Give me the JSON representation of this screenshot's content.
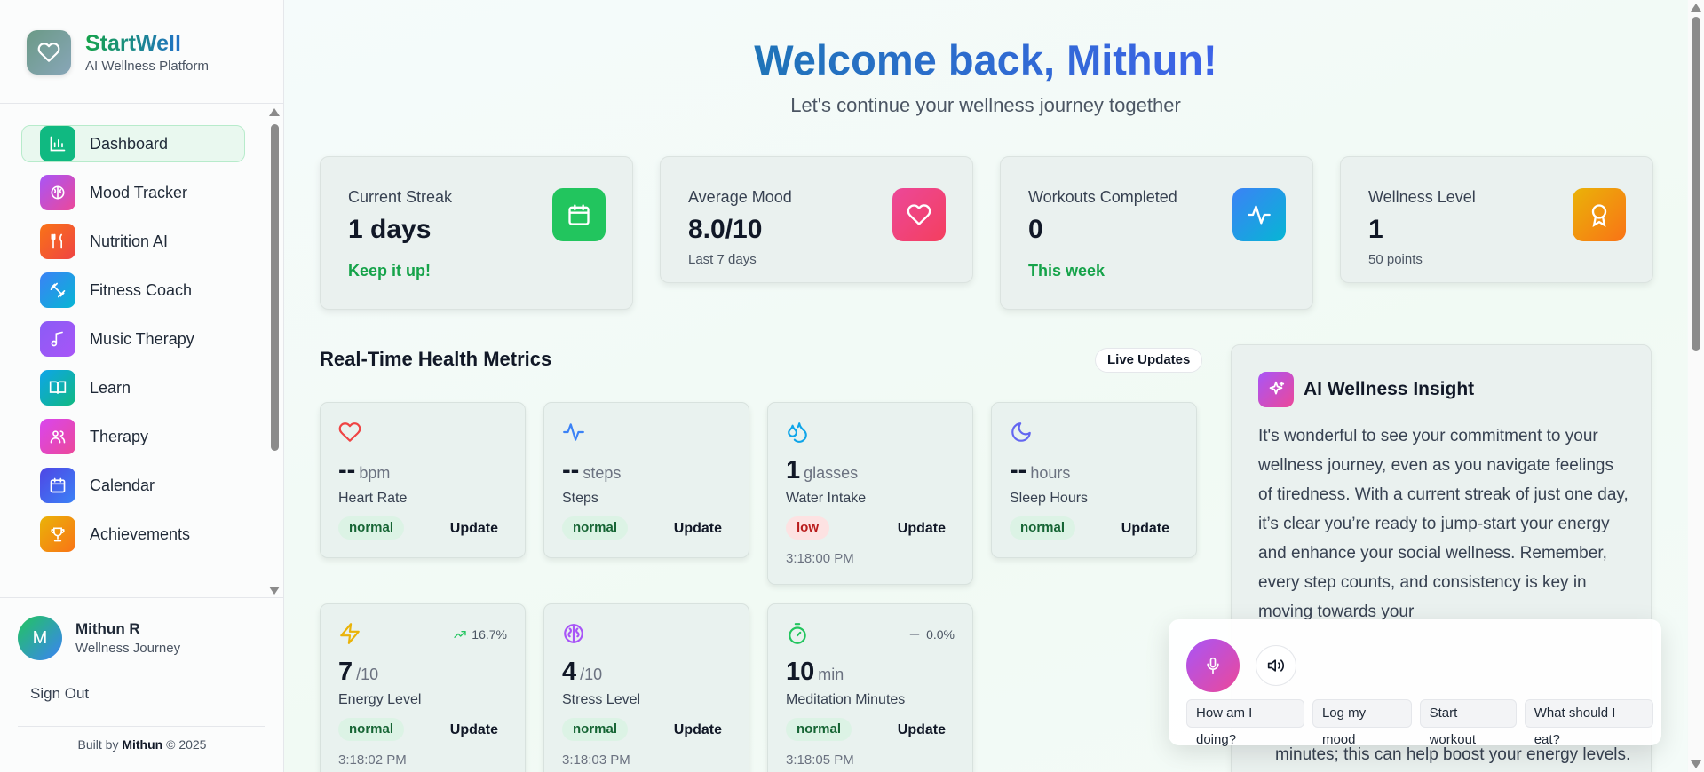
{
  "brand": {
    "name": "StartWell",
    "subtitle": "AI Wellness Platform"
  },
  "nav": {
    "items": [
      {
        "label": "Dashboard",
        "icon": "bar-chart-icon",
        "color": "#10b981",
        "active": true
      },
      {
        "label": "Mood Tracker",
        "icon": "brain-icon",
        "color": "#a855f7"
      },
      {
        "label": "Nutrition AI",
        "icon": "utensils-icon",
        "color": "#f97316"
      },
      {
        "label": "Fitness Coach",
        "icon": "dumbbell-icon",
        "color": "#3b82f6"
      },
      {
        "label": "Music Therapy",
        "icon": "music-icon",
        "color": "#8b5cf6"
      },
      {
        "label": "Learn",
        "icon": "book-icon",
        "color": "#0ea5e9"
      },
      {
        "label": "Therapy",
        "icon": "users-icon",
        "color": "#d946ef"
      },
      {
        "label": "Calendar",
        "icon": "calendar-icon",
        "color": "#4f46e5"
      },
      {
        "label": "Achievements",
        "icon": "trophy-icon",
        "color": "#f59e0b"
      }
    ]
  },
  "user": {
    "initial": "M",
    "name": "Mithun R",
    "subtitle": "Wellness Journey",
    "sign_out": "Sign Out"
  },
  "footer": {
    "prefix": "Built by",
    "author": "Mithun",
    "suffix": "© 2025"
  },
  "header": {
    "title": "Welcome back, Mithun!",
    "subtitle": "Let's continue your wellness journey together"
  },
  "stats": [
    {
      "label": "Current Streak",
      "value": "1 days",
      "note": "Keep it up!",
      "icon": "calendar-icon",
      "color": "#22c55e"
    },
    {
      "label": "Average Mood",
      "value": "8.0/10",
      "small": "Last 7 days",
      "icon": "heart-icon",
      "color": "#f43f5e"
    },
    {
      "label": "Workouts Completed",
      "value": "0",
      "note": "This week",
      "icon": "activity-icon",
      "color": "#3b82f6"
    },
    {
      "label": "Wellness Level",
      "value": "1",
      "small": "50 points",
      "icon": "award-icon",
      "color": "#f59e0b"
    }
  ],
  "metrics_section": {
    "title": "Real-Time Health Metrics",
    "badge": "Live Updates"
  },
  "metrics": [
    {
      "value": "--",
      "unit": "bpm",
      "label": "Heart Rate",
      "status": "normal",
      "update": "Update",
      "icon": "heart-icon",
      "icon_color": "#ef4444"
    },
    {
      "value": "--",
      "unit": "steps",
      "label": "Steps",
      "status": "normal",
      "update": "Update",
      "icon": "activity-icon",
      "icon_color": "#3b82f6"
    },
    {
      "value": "1",
      "unit": "glasses",
      "label": "Water Intake",
      "status": "low",
      "update": "Update",
      "time": "3:18:00 PM",
      "icon": "droplets-icon",
      "icon_color": "#0ea5e9"
    },
    {
      "value": "--",
      "unit": "hours",
      "label": "Sleep Hours",
      "status": "normal",
      "update": "Update",
      "icon": "moon-icon",
      "icon_color": "#6366f1"
    },
    {
      "value": "7",
      "unit": "/10",
      "label": "Energy Level",
      "status": "normal",
      "update": "Update",
      "time": "3:18:02 PM",
      "trend": "16.7%",
      "icon": "zap-icon",
      "icon_color": "#eab308"
    },
    {
      "value": "4",
      "unit": "/10",
      "label": "Stress Level",
      "status": "normal",
      "update": "Update",
      "time": "3:18:03 PM",
      "icon": "brain-icon",
      "icon_color": "#a855f7"
    },
    {
      "value": "10",
      "unit": "min",
      "label": "Meditation Minutes",
      "status": "normal",
      "update": "Update",
      "time": "3:18:05 PM",
      "trend": "0.0%",
      "icon": "timer-icon",
      "icon_color": "#22c55e"
    }
  ],
  "insight": {
    "title": "AI Wellness Insight",
    "body": "It's wonderful to see your commitment to your wellness journey, even as you navigate feelings of tiredness. With a current streak of just one day, it’s clear you’re ready to jump-start your energy and enhance your social wellness. Remember, every step counts, and consistency is key in moving towards your",
    "tail": "minutes; this can help boost your energy levels."
  },
  "voice": {
    "mic_icon": "mic-icon",
    "speaker_icon": "volume-icon",
    "quick_actions": [
      "How am I doing?",
      "Log my mood",
      "Start workout",
      "What should I eat?"
    ]
  }
}
